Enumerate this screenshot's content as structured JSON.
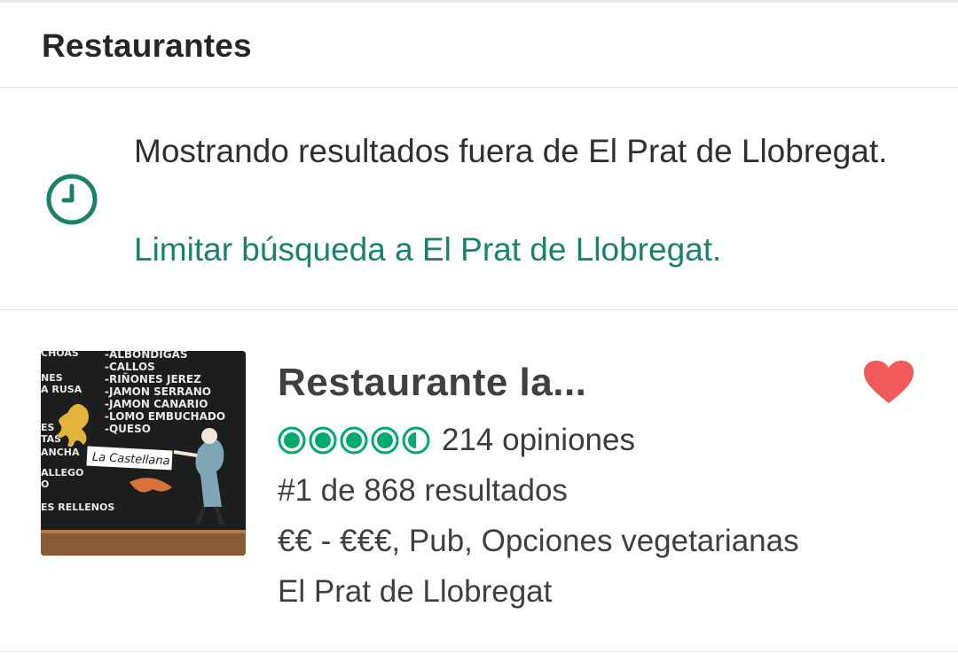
{
  "header": {
    "title": "Restaurantes"
  },
  "notice": {
    "text": "Mostrando resultados fuera de El Prat de Llobregat.",
    "link": "Limitar búsqueda a El Prat de Llobregat.",
    "icon": "clock-icon",
    "accent_color": "#18826b"
  },
  "listing": {
    "name": "Restaurante la...",
    "rating": 4.5,
    "rating_max": 5,
    "reviews": "214 opiniones",
    "rank": "#1 de 868 resultados",
    "tags": "€€ - €€€, Pub, Opciones vegetarianas",
    "location": "El Prat de Llobregat",
    "favorite_icon": "heart-icon",
    "favorite_color": "#f05a5a",
    "rating_color": "#00aa6c",
    "photo": {
      "menu_items": [
        "ALBONDIGAS",
        "CALLOS",
        "RIÑONES JEREZ",
        "JAMON SERRANO",
        "JAMON CANARIO",
        "LOMO EMBUCHADO",
        "QUESO"
      ],
      "left_items": [
        "CHOAS",
        "NES",
        "A RUSA",
        "ES",
        "TAS",
        "ANCHA",
        "ALLEGO",
        "O",
        "ES RELLENOS"
      ],
      "sign": "La Castellana"
    }
  }
}
